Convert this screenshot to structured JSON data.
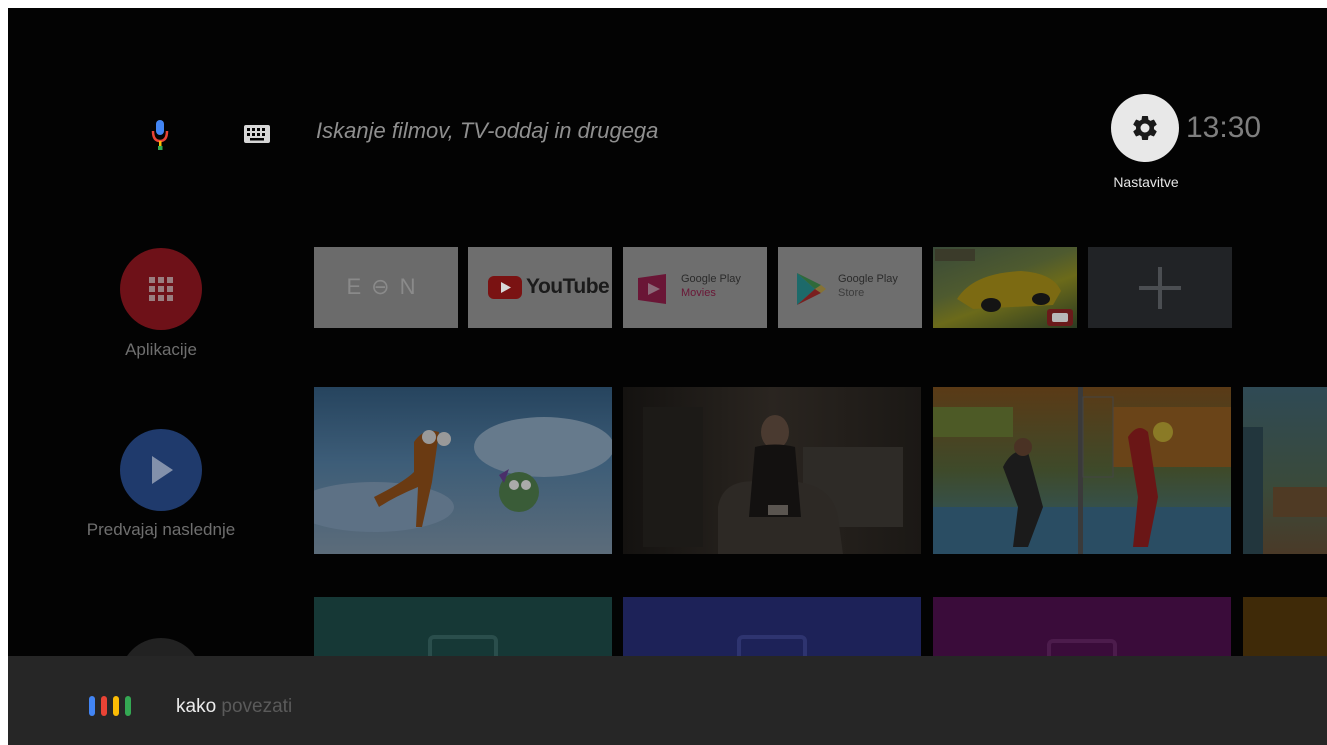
{
  "search": {
    "placeholder": "Iskanje filmov, TV-oddaj in drugega"
  },
  "settings": {
    "label": "Nastavitve"
  },
  "clock": "13:30",
  "sidebar": {
    "apps_label": "Aplikacije",
    "play_next_label": "Predvajaj naslednje"
  },
  "apps": {
    "eon": "E⊖N",
    "youtube": "YouTube",
    "play_movies_line1": "Google Play",
    "play_movies_line2": "Movies",
    "play_store_line1": "Google Play",
    "play_store_line2": "Store"
  },
  "assistant": {
    "query_typed": "kako",
    "query_suggest": " povezati"
  },
  "colors": {
    "google_blue": "#4285f4",
    "google_red": "#ea4335",
    "google_yellow": "#fbbc05",
    "google_green": "#34a853"
  }
}
